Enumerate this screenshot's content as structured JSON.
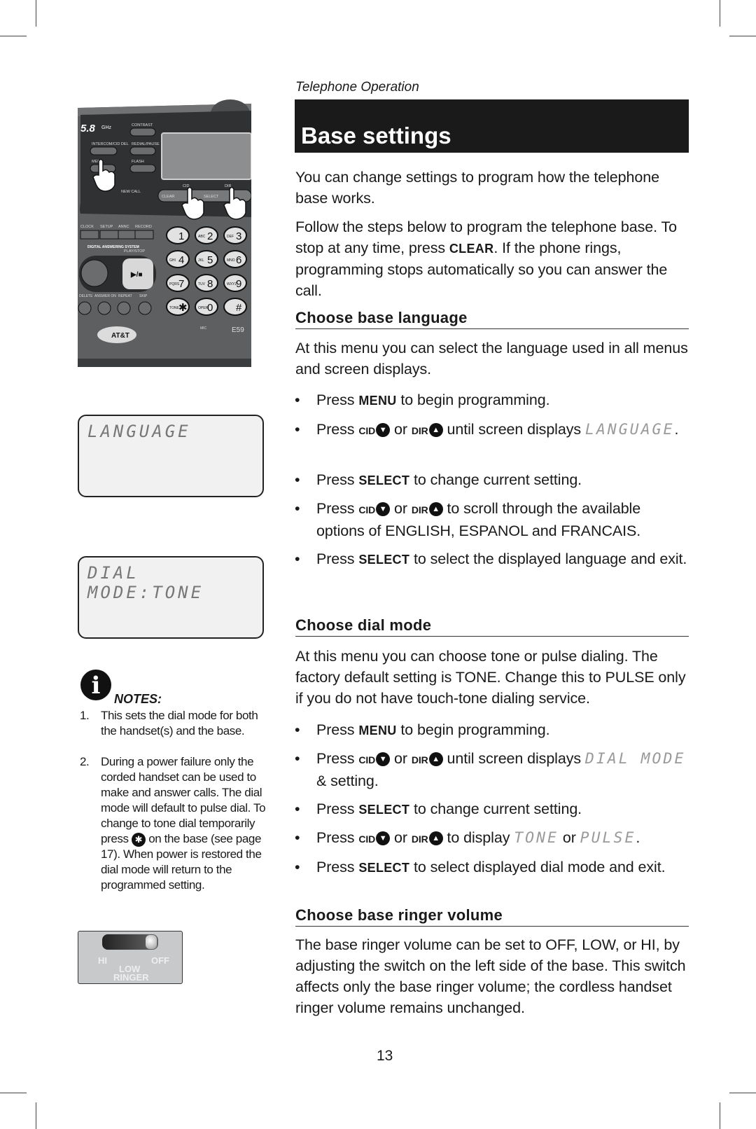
{
  "header": {
    "section": "Telephone Operation",
    "title": "Base settings"
  },
  "intro": [
    [
      {
        "t": "You can change settings to program how the telephone base works."
      }
    ],
    [
      {
        "t": "Follow the steps below to program the telephone base. To stop at any time, press "
      },
      {
        "t": "CLEAR",
        "s": "b"
      },
      {
        "t": ". If the phone rings, programming stops automatically so you can answer the call."
      }
    ]
  ],
  "sections": [
    {
      "heading": "Choose base language",
      "para": [
        {
          "t": "At this menu you can select the language used in all menus and screen displays."
        }
      ],
      "bullets": [
        [
          {
            "t": "Press "
          },
          {
            "t": "MENU",
            "s": "b"
          },
          {
            "t": " to begin programming."
          }
        ],
        [
          {
            "t": "Press "
          },
          {
            "t": "CID",
            "s": "k"
          },
          {
            "t": "▼",
            "s": "a"
          },
          {
            "t": "  or "
          },
          {
            "t": "DIR",
            "s": "k"
          },
          {
            "t": "▲",
            "s": "a"
          },
          {
            "t": "  until screen displays "
          },
          {
            "t": "LANGUAGE",
            "s": "l"
          },
          {
            "t": "."
          }
        ],
        [
          {
            "t": "Press "
          },
          {
            "t": "SELECT",
            "s": "b"
          },
          {
            "t": " to change current setting."
          }
        ],
        [
          {
            "t": "Press "
          },
          {
            "t": "CID",
            "s": "k"
          },
          {
            "t": "▼",
            "s": "a"
          },
          {
            "t": "  or "
          },
          {
            "t": "DIR",
            "s": "k"
          },
          {
            "t": "▲",
            "s": "a"
          },
          {
            "t": "  to scroll through the available options of ENGLISH, ESPANOL and FRANCAIS."
          }
        ],
        [
          {
            "t": "Press "
          },
          {
            "t": "SELECT",
            "s": "b"
          },
          {
            "t": " to select the displayed language and exit."
          }
        ]
      ]
    },
    {
      "heading": "Choose dial mode",
      "para": [
        {
          "t": "At this menu you can choose tone or pulse dialing. The factory default setting is TONE. Change this to PULSE only if you do not have touch-tone dialing service."
        }
      ],
      "bullets": [
        [
          {
            "t": "Press "
          },
          {
            "t": "MENU",
            "s": "b"
          },
          {
            "t": " to begin programming."
          }
        ],
        [
          {
            "t": "Press "
          },
          {
            "t": "CID",
            "s": "k"
          },
          {
            "t": "▼",
            "s": "a"
          },
          {
            "t": "  or "
          },
          {
            "t": "DIR",
            "s": "k"
          },
          {
            "t": "▲",
            "s": "a"
          },
          {
            "t": "  until screen displays "
          },
          {
            "t": "DIAL MODE",
            "s": "l"
          },
          {
            "t": " & setting."
          }
        ],
        [
          {
            "t": "Press "
          },
          {
            "t": "SELECT",
            "s": "b"
          },
          {
            "t": " to change current setting."
          }
        ],
        [
          {
            "t": "Press "
          },
          {
            "t": "CID",
            "s": "k"
          },
          {
            "t": "▼",
            "s": "a"
          },
          {
            "t": "  or "
          },
          {
            "t": "DIR",
            "s": "k"
          },
          {
            "t": "▲",
            "s": "a"
          },
          {
            "t": "  to display "
          },
          {
            "t": "TONE",
            "s": "l"
          },
          {
            "t": " or "
          },
          {
            "t": "PULSE",
            "s": "l"
          },
          {
            "t": "."
          }
        ],
        [
          {
            "t": "Press "
          },
          {
            "t": "SELECT",
            "s": "b"
          },
          {
            "t": " to select displayed dial mode and exit."
          }
        ]
      ]
    },
    {
      "heading": "Choose base ringer volume",
      "para": [
        {
          "t": "The base ringer volume can be set to OFF, LOW, or HI, by adjusting the switch on the left side of the base. This switch affects only the base ringer volume; the cordless handset ringer volume remains unchanged."
        }
      ],
      "bullets": []
    }
  ],
  "lcd_screens": [
    "LANGUAGE",
    "DIAL MODE:TONE"
  ],
  "notes": {
    "title": "NOTES:",
    "items": [
      {
        "num": "1.",
        "text": "This sets the dial mode for both the handset(s) and the base."
      },
      {
        "num": "2.",
        "before": "During a power failure only the corded handset can be used to make and answer calls. The dial mode will default to pulse dial. To change to tone dial temporarily press ",
        "icon_label": "✱",
        "after": " on the base (see page 17). When power is restored the dial mode will return to the programmed setting."
      }
    ]
  },
  "phone_image": {
    "band": "5.8",
    "ghz": "GHz",
    "brand": "AT&T",
    "model": "E59",
    "buttons": [
      "CONTRAST",
      "INTERCOM/CID DEL",
      "REDIAL/PAUSE",
      "MENU",
      "FLASH",
      "NEW CALL",
      "CID",
      "DIR",
      "CLEAR",
      "SELECT",
      "CLOCK",
      "SETUP",
      "ANNC",
      "RECORD",
      "PLAY/STOP",
      "DELETE",
      "ANSWER ON",
      "REPEAT",
      "SKIP",
      "MIC",
      "DIGITAL ANSWERING SYSTEM"
    ],
    "keys": [
      [
        "1",
        ""
      ],
      [
        "2",
        "ABC"
      ],
      [
        "3",
        "DEF"
      ],
      [
        "4",
        "GHI"
      ],
      [
        "5",
        "JKL"
      ],
      [
        "6",
        "MNO"
      ],
      [
        "7",
        "PQRS"
      ],
      [
        "8",
        "TUV"
      ],
      [
        "9",
        "WXYZ"
      ],
      [
        "✱",
        "TONE"
      ],
      [
        "0",
        "OPER"
      ],
      [
        "#",
        ""
      ]
    ]
  },
  "ringer_switch": {
    "hi": "HI",
    "low": "LOW",
    "off": "OFF",
    "label": "RINGER",
    "position": "OFF"
  },
  "page_number": "13"
}
